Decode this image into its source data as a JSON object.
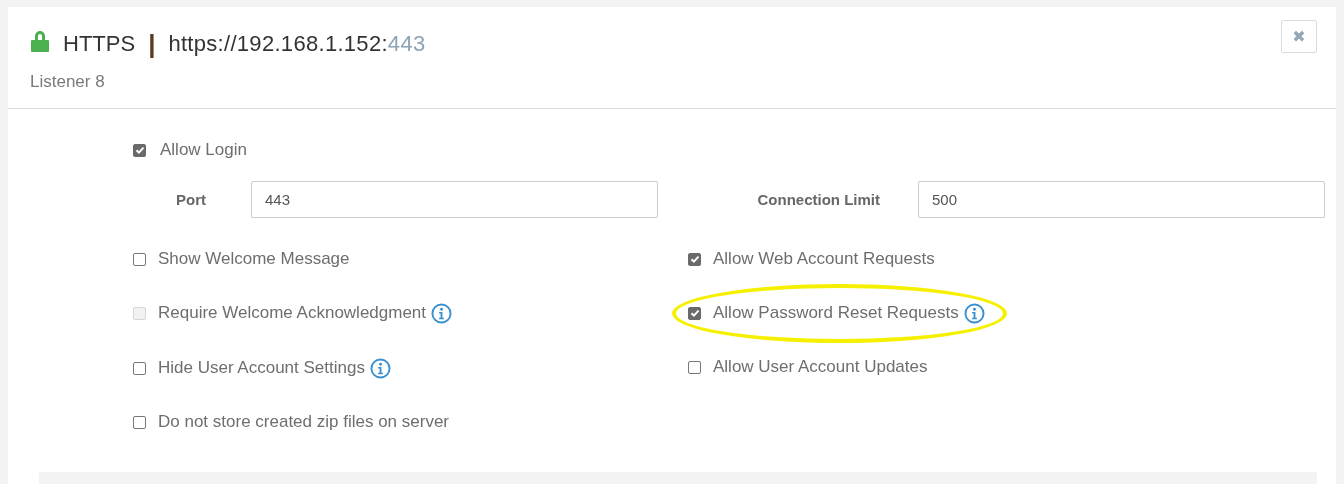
{
  "header": {
    "protocol": "HTTPS",
    "separator": "|",
    "url": "https://192.168.1.152:",
    "port": "443",
    "subtitle": "Listener 8",
    "close": "✖"
  },
  "allow_login": {
    "label": "Allow Login",
    "checked": true,
    "disabled": false
  },
  "fields": [
    {
      "label": "Port",
      "value": "443"
    },
    {
      "label": "Connection Limit",
      "value": "500"
    }
  ],
  "left_options": [
    {
      "label": "Show Welcome Message",
      "checked": false,
      "disabled": false,
      "info": false
    },
    {
      "label": "Require Welcome Acknowledgment",
      "checked": false,
      "disabled": true,
      "info": true
    },
    {
      "label": "Hide User Account Settings",
      "checked": false,
      "disabled": false,
      "info": true
    },
    {
      "label": "Do not store created zip files on server",
      "checked": false,
      "disabled": false,
      "info": false
    }
  ],
  "right_options": [
    {
      "label": "Allow Web Account Requests",
      "checked": true,
      "disabled": false,
      "info": false,
      "highlighted": false
    },
    {
      "label": "Allow Password Reset Requests",
      "checked": true,
      "disabled": false,
      "info": true,
      "highlighted": true
    },
    {
      "label": "Allow User Account Updates",
      "checked": false,
      "disabled": false,
      "info": false,
      "highlighted": false
    }
  ]
}
